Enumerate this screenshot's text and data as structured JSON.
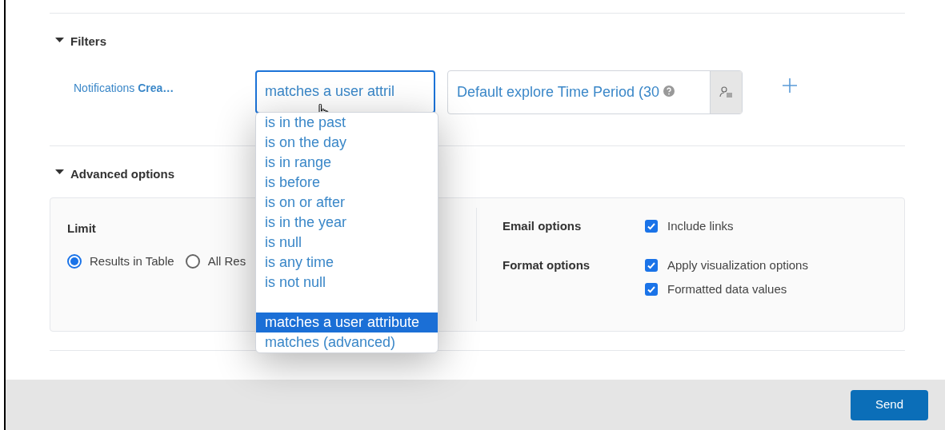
{
  "filters": {
    "title": "Filters",
    "expanded": true,
    "field_label": "Notifications **Crea…**",
    "operator_value": "matches a user attril",
    "value": "Default explore Time Period (30"
  },
  "operator_menu": {
    "groups": [
      [
        {
          "label": "is in the past",
          "selected": false
        },
        {
          "label": "is on the day",
          "selected": false
        },
        {
          "label": "is in range",
          "selected": false
        },
        {
          "label": "is before",
          "selected": false
        },
        {
          "label": "is on or after",
          "selected": false
        },
        {
          "label": "is in the year",
          "selected": false
        },
        {
          "label": "is null",
          "selected": false
        },
        {
          "label": "is any time",
          "selected": false
        },
        {
          "label": "is not null",
          "selected": false
        }
      ],
      [
        {
          "label": "matches a user attribute",
          "selected": true
        },
        {
          "label": "matches (advanced)",
          "selected": false
        }
      ]
    ]
  },
  "advanced": {
    "title": "Advanced options",
    "expanded": true,
    "limit": {
      "label": "Limit",
      "radios": [
        {
          "label": "Results in Table",
          "selected": true
        },
        {
          "label": "All Res",
          "selected": false
        }
      ]
    },
    "email_options": {
      "label": "Email options",
      "checkboxes": [
        {
          "label": "Include links",
          "checked": true
        }
      ]
    },
    "format_options": {
      "label": "Format options",
      "checkboxes": [
        {
          "label": "Apply visualization options",
          "checked": true
        },
        {
          "label": "Formatted data values",
          "checked": true
        }
      ]
    }
  },
  "footer": {
    "send_button": "Send"
  }
}
